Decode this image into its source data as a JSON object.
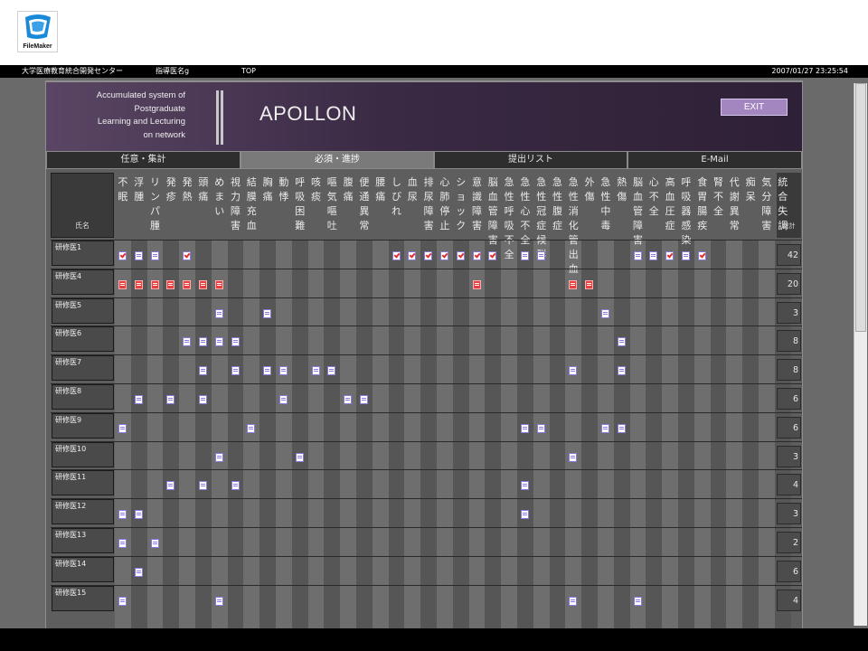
{
  "logo": {
    "text": "FileMaker"
  },
  "topbar": {
    "org": "大学医療教育統合開発センター",
    "user": "指導医名g",
    "location": "TOP",
    "datetime": "2007/01/27 23:25:54"
  },
  "header": {
    "tagline": [
      "Accumulated system of",
      "Postgraduate",
      "Learning and Lecturing",
      "on network"
    ],
    "title": "APOLLON",
    "exit_label": "EXIT"
  },
  "tabs": [
    {
      "label": "任意・集計",
      "active": false
    },
    {
      "label": "必須・進捗",
      "active": true
    },
    {
      "label": "提出リスト",
      "active": false
    },
    {
      "label": "E-Mail",
      "active": false
    }
  ],
  "table": {
    "name_header": "氏名",
    "total_header": "総計",
    "symptoms": [
      "不眠",
      "浮腫",
      "リンパ腫",
      "発疹",
      "発熱",
      "頭痛",
      "めまい",
      "視力障害",
      "結膜充血",
      "胸痛",
      "動悸",
      "呼吸困難",
      "咳痰",
      "嘔気嘔吐",
      "腹痛",
      "便通異常",
      "腰痛",
      "しびれ",
      "血尿",
      "排尿障害",
      "心肺停止",
      "ショック",
      "意識障害",
      "脳血管障害",
      "急性呼吸不全",
      "急性心不全",
      "急性冠症候群",
      "急性腹症",
      "急性消化管出血",
      "外傷",
      "急性中毒",
      "熱傷",
      "脳血管障害",
      "心不全",
      "高血圧症",
      "呼吸器感染",
      "食胃腸疾",
      "腎不全",
      "代謝異常",
      "痴呆",
      "気分障害",
      "統合失調"
    ],
    "rows": [
      {
        "name": "研修医1",
        "total": "42",
        "marks": [
          {
            "c": 0,
            "t": "check"
          },
          {
            "c": 1,
            "t": "normal"
          },
          {
            "c": 2,
            "t": "normal"
          },
          {
            "c": 4,
            "t": "check"
          },
          {
            "c": 17,
            "t": "check"
          },
          {
            "c": 18,
            "t": "check"
          },
          {
            "c": 19,
            "t": "check"
          },
          {
            "c": 20,
            "t": "check"
          },
          {
            "c": 21,
            "t": "check"
          },
          {
            "c": 22,
            "t": "check"
          },
          {
            "c": 23,
            "t": "check"
          },
          {
            "c": 25,
            "t": "normal"
          },
          {
            "c": 26,
            "t": "normal"
          },
          {
            "c": 32,
            "t": "normal"
          },
          {
            "c": 33,
            "t": "normal"
          },
          {
            "c": 34,
            "t": "check"
          },
          {
            "c": 35,
            "t": "normal"
          },
          {
            "c": 36,
            "t": "check"
          }
        ]
      },
      {
        "name": "研修医4",
        "total": "20",
        "marks": [
          {
            "c": 0,
            "t": "red"
          },
          {
            "c": 1,
            "t": "red"
          },
          {
            "c": 2,
            "t": "red"
          },
          {
            "c": 3,
            "t": "red"
          },
          {
            "c": 4,
            "t": "red"
          },
          {
            "c": 5,
            "t": "red"
          },
          {
            "c": 6,
            "t": "red"
          },
          {
            "c": 22,
            "t": "red"
          },
          {
            "c": 28,
            "t": "red"
          },
          {
            "c": 29,
            "t": "red"
          }
        ]
      },
      {
        "name": "研修医5",
        "total": "3",
        "marks": [
          {
            "c": 6,
            "t": "normal"
          },
          {
            "c": 9,
            "t": "normal"
          },
          {
            "c": 30,
            "t": "normal"
          }
        ]
      },
      {
        "name": "研修医6",
        "total": "8",
        "marks": [
          {
            "c": 4,
            "t": "normal"
          },
          {
            "c": 5,
            "t": "normal"
          },
          {
            "c": 6,
            "t": "normal"
          },
          {
            "c": 7,
            "t": "normal"
          },
          {
            "c": 31,
            "t": "normal"
          }
        ]
      },
      {
        "name": "研修医7",
        "total": "8",
        "marks": [
          {
            "c": 5,
            "t": "normal"
          },
          {
            "c": 7,
            "t": "normal"
          },
          {
            "c": 9,
            "t": "normal"
          },
          {
            "c": 10,
            "t": "normal"
          },
          {
            "c": 12,
            "t": "normal"
          },
          {
            "c": 13,
            "t": "normal"
          },
          {
            "c": 28,
            "t": "normal"
          },
          {
            "c": 31,
            "t": "normal"
          }
        ]
      },
      {
        "name": "研修医8",
        "total": "6",
        "marks": [
          {
            "c": 1,
            "t": "normal"
          },
          {
            "c": 3,
            "t": "normal"
          },
          {
            "c": 5,
            "t": "normal"
          },
          {
            "c": 10,
            "t": "normal"
          },
          {
            "c": 14,
            "t": "normal"
          },
          {
            "c": 15,
            "t": "normal"
          }
        ]
      },
      {
        "name": "研修医9",
        "total": "6",
        "marks": [
          {
            "c": 0,
            "t": "normal"
          },
          {
            "c": 8,
            "t": "normal"
          },
          {
            "c": 25,
            "t": "normal"
          },
          {
            "c": 26,
            "t": "normal"
          },
          {
            "c": 30,
            "t": "normal"
          },
          {
            "c": 31,
            "t": "normal"
          }
        ]
      },
      {
        "name": "研修医10",
        "total": "3",
        "marks": [
          {
            "c": 6,
            "t": "normal"
          },
          {
            "c": 11,
            "t": "normal"
          },
          {
            "c": 28,
            "t": "normal"
          }
        ]
      },
      {
        "name": "研修医11",
        "total": "4",
        "marks": [
          {
            "c": 3,
            "t": "normal"
          },
          {
            "c": 5,
            "t": "normal"
          },
          {
            "c": 7,
            "t": "normal"
          },
          {
            "c": 25,
            "t": "normal"
          }
        ]
      },
      {
        "name": "研修医12",
        "total": "3",
        "marks": [
          {
            "c": 0,
            "t": "normal"
          },
          {
            "c": 1,
            "t": "normal"
          },
          {
            "c": 25,
            "t": "normal"
          }
        ]
      },
      {
        "name": "研修医13",
        "total": "2",
        "marks": [
          {
            "c": 0,
            "t": "normal"
          },
          {
            "c": 2,
            "t": "normal"
          }
        ]
      },
      {
        "name": "研修医14",
        "total": "6",
        "marks": [
          {
            "c": 1,
            "t": "normal"
          }
        ]
      },
      {
        "name": "研修医15",
        "total": "4",
        "marks": [
          {
            "c": 0,
            "t": "normal"
          },
          {
            "c": 6,
            "t": "normal"
          },
          {
            "c": 28,
            "t": "normal"
          },
          {
            "c": 32,
            "t": "normal"
          }
        ]
      }
    ]
  },
  "colors": {
    "header_purple": "#3a2a44",
    "exit_button": "#a386c0",
    "mark_red": "#e84040",
    "mark_outline": "#8878d8"
  }
}
